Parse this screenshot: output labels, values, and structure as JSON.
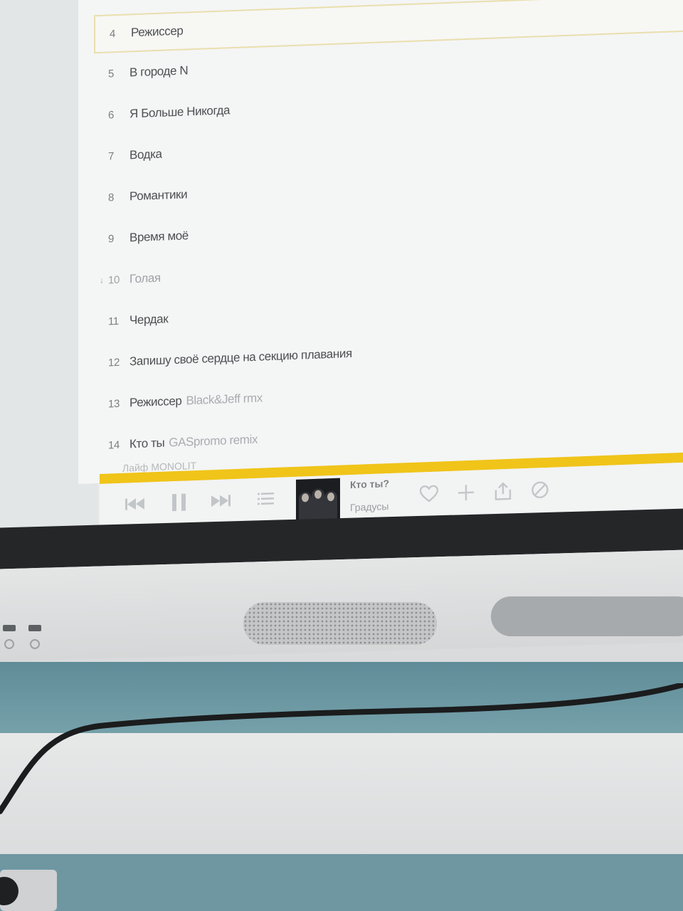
{
  "tracklist": [
    {
      "num": "4",
      "title": "Режиссер",
      "version": "",
      "active": true
    },
    {
      "num": "5",
      "title": "В городе N",
      "version": ""
    },
    {
      "num": "6",
      "title": "Я Больше Никогда",
      "version": ""
    },
    {
      "num": "7",
      "title": "Водка",
      "version": ""
    },
    {
      "num": "8",
      "title": "Романтики",
      "version": ""
    },
    {
      "num": "9",
      "title": "Время моё",
      "version": ""
    },
    {
      "num": "10",
      "title": "Голая",
      "version": "",
      "dim": true
    },
    {
      "num": "11",
      "title": "Чердак",
      "version": ""
    },
    {
      "num": "12",
      "title": "Запишу своё сердце на секцию плавания",
      "version": ""
    },
    {
      "num": "13",
      "title": "Режиссер",
      "version": "Black&Jeff rmx"
    },
    {
      "num": "14",
      "title": "Кто ты",
      "version": "GASpromo remix"
    }
  ],
  "next_label_faded": "Лайф",
  "next_label": "MONOLIT",
  "player": {
    "track_title": "Кто ты?",
    "artist": "Градусы",
    "accent_color": "#f0c419"
  },
  "icons": {
    "prev": "skip-back-icon",
    "pause": "pause-icon",
    "next": "skip-forward-icon",
    "queue": "queue-list-icon",
    "like": "heart-icon",
    "add": "plus-icon",
    "share": "share-icon",
    "block": "block-icon"
  }
}
